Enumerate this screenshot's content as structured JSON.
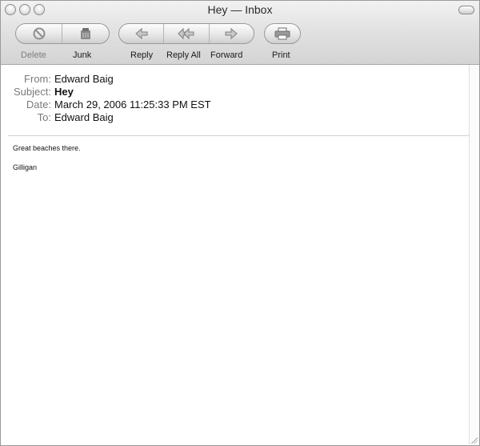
{
  "window": {
    "title": "Hey — Inbox"
  },
  "toolbar": {
    "delete_label": "Delete",
    "junk_label": "Junk",
    "reply_label": "Reply",
    "reply_all_label": "Reply All",
    "forward_label": "Forward",
    "print_label": "Print"
  },
  "message": {
    "from_label": "From:",
    "from_value": "Edward Baig",
    "subject_label": "Subject:",
    "subject_value": "Hey",
    "date_label": "Date:",
    "date_value": "March 29, 2006 11:25:33 PM EST",
    "to_label": "To:",
    "to_value": "Edward Baig",
    "body_line_1": "Great beaches there.",
    "body_line_2": "Gilligan"
  },
  "colors": {
    "disabled_label": "#7d7d7d",
    "header_key": "#7a7a7a"
  },
  "icons": {
    "delete": "no-entry-icon",
    "junk": "junk-bag-icon",
    "reply": "reply-arrow-icon",
    "reply_all": "reply-all-arrow-icon",
    "forward": "forward-arrow-icon",
    "print": "printer-icon"
  }
}
